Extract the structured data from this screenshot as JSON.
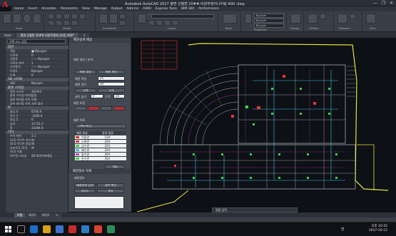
{
  "window": {
    "app_logo": "A",
    "title": "Autodesk AutoCAD 2017   평면 신평면 20##-이관주엔지니어링 A00 .dwg",
    "controls": [
      "—",
      "❐",
      "✕"
    ]
  },
  "menu": {
    "items": [
      "Home",
      "Insert",
      "Annotate",
      "Parametric",
      "View",
      "Manage",
      "Output",
      "Add-ins",
      "A360",
      "Express Tools",
      "BIM 360",
      "Performance"
    ]
  },
  "ribbon": {
    "layer_field": "0",
    "bylayer_1": "ByLayer",
    "bylayer_2": "ByLayer",
    "bylayer_3": "ByLayer",
    "groups": [
      "Draw",
      "Modify",
      "Annotation",
      "Layers",
      "Block",
      "Properties",
      "Groups",
      "Utilities",
      "Clipboard",
      "View"
    ]
  },
  "doctabs": [
    "Start",
    "평면 신평면 20##-이관주엔지니어링 A00*",
    "+"
  ],
  "properties": {
    "selector": "선택 요소 없음",
    "sections": [
      {
        "title": "일반",
        "rows": [
          {
            "k": "색상",
            "v": "■ ByLayer"
          },
          {
            "k": "도면층",
            "v": "0"
          },
          {
            "k": "선종류",
            "v": "—— ByLayer"
          },
          {
            "k": "선종류 축척",
            "v": "1"
          },
          {
            "k": "선가중치",
            "v": "—— ByLayer"
          },
          {
            "k": "투명도",
            "v": "ByLayer"
          },
          {
            "k": "두께",
            "v": "0"
          }
        ]
      },
      {
        "title": "3D 시각화",
        "rows": [
          {
            "k": "재료",
            "v": "ByLayer"
          }
        ]
      },
      {
        "title": "플롯 스타일",
        "rows": [
          {
            "k": "플롯 스타일",
            "v": "색상종속"
          },
          {
            "k": "플롯 스타일 테이블",
            "v": "없음"
          },
          {
            "k": "플롯 테이블 부착",
            "v": "모형"
          },
          {
            "k": "플롯 테이블 유형",
            "v": "사용 불가"
          }
        ]
      },
      {
        "title": "뷰",
        "rows": [
          {
            "k": "중심 X",
            "v": "6756.9"
          },
          {
            "k": "중심 Y",
            "v": "-3204.6"
          },
          {
            "k": "중심 Z",
            "v": "0"
          },
          {
            "k": "높이",
            "v": "11731.2"
          },
          {
            "k": "폭",
            "v": "23194.9"
          }
        ]
      },
      {
        "title": "기타",
        "rows": [
          {
            "k": "주석 축척",
            "v": "1:1"
          },
          {
            "k": "UCS 아이콘 켜기",
            "v": "예"
          },
          {
            "k": "UCS 아이콘 원점",
            "v": "예"
          },
          {
            "k": "뷰포트당 UCS",
            "v": "예"
          },
          {
            "k": "UCS 이름",
            "v": ""
          },
          {
            "k": "비주얼 스타일",
            "v": "2D 와이어프레임"
          }
        ]
      }
    ]
  },
  "palette": {
    "title": "배관설계 패널",
    "section1": "배관 생성 / 분석",
    "btn_pipe": "배관 생성",
    "btn_calc": "배관 계산",
    "lbl_diameter": "배관 직경",
    "val_diameter": "25",
    "lbl_length": "배관 길이",
    "val_length": "20",
    "btn_a": "단위",
    "btn_b": "도면",
    "lbl_height": "설치 높이",
    "val_height": "0",
    "lbl_spacing": "간격",
    "val_spacing": "20",
    "section2": "배관 조정",
    "section3": "배관 목록",
    "dropdown": "TYPE-A(1)",
    "list_header": [
      "배관 종류",
      "관경 종류"
    ],
    "list_rows": [
      {
        "name": "이중관",
        "size": "15A"
      },
      {
        "name": "소화관",
        "size": "20A"
      },
      {
        "name": "급수관",
        "size": "25A"
      },
      {
        "name": "배수관",
        "size": "32A"
      },
      {
        "name": "통기관",
        "size": "40A"
      },
      {
        "name": "온수관",
        "size": "50A"
      }
    ],
    "btn_apply": "적용"
  },
  "palette2": {
    "title": "배관정보 목록",
    "label": "배관정보",
    "btn1": "배관정보 입력",
    "btn2": "정보 확인",
    "btn3": "리스트",
    "btn4": "복사"
  },
  "cmdline": "명령 입력",
  "layout_tabs": [
    "모형",
    "배치1",
    "배치2",
    "+"
  ],
  "taskbar": {
    "time": "오후 10:35",
    "date": "2017-10-12",
    "lang": "한"
  },
  "colors": {
    "accent_yellow": "#e8e23a",
    "cad_cyan": "#3ec4e6",
    "cad_green": "#35d44a",
    "cad_red": "#e2353a",
    "cad_magenta": "#c13cc4"
  }
}
